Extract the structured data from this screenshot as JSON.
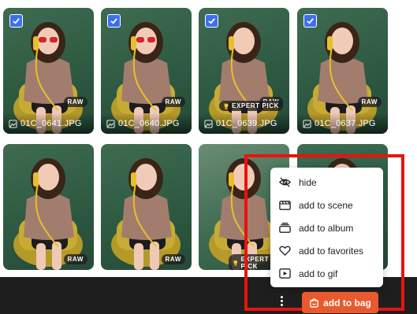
{
  "grid": {
    "row1": [
      {
        "filename": "01C_0641.JPG",
        "selected": true,
        "badge": "RAW"
      },
      {
        "filename": "01C_0640.JPG",
        "selected": true,
        "badge": "RAW"
      },
      {
        "filename": "01C_0639.JPG",
        "selected": true,
        "badge": "RAW",
        "pick": "EXPERT PICK"
      },
      {
        "filename": "01C_0637.JPG",
        "selected": true,
        "badge": "RAW"
      }
    ],
    "row2": [
      {
        "badge": "RAW"
      },
      {
        "badge": "RAW"
      },
      {
        "pick": "EXPERT PICK"
      },
      {}
    ]
  },
  "context_menu": {
    "items": [
      {
        "label": "hide",
        "icon": "eye-off-icon"
      },
      {
        "label": "add to scene",
        "icon": "clapperboard-icon"
      },
      {
        "label": "add to album",
        "icon": "album-stack-icon"
      },
      {
        "label": "add to favorites",
        "icon": "heart-icon"
      },
      {
        "label": "add to gif",
        "icon": "gif-play-icon"
      }
    ]
  },
  "bottom_bar": {
    "add_to_bag_label": "add to bag"
  },
  "colors": {
    "checkbox": "#3d6ff4",
    "accent_button": "#e85a2e",
    "highlight_frame": "#e8140c",
    "bottom_bar": "#1e1e1e"
  }
}
